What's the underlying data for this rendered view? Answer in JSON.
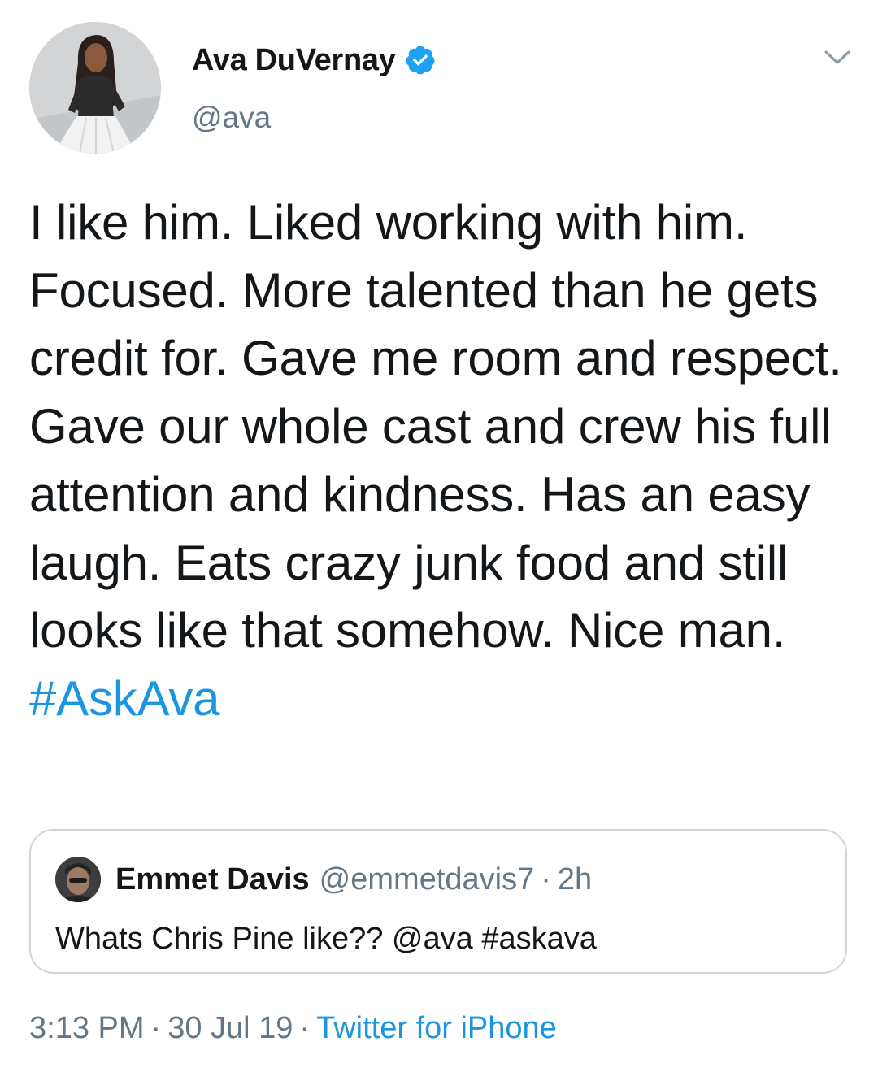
{
  "author": {
    "display_name": "Ava DuVernay",
    "handle": "@ava",
    "avatar_icon": "profile-photo",
    "verified_icon": "verified-badge-icon",
    "verified_color": "#1da1f2"
  },
  "menu": {
    "caret_icon": "chevron-down-icon"
  },
  "tweet": {
    "text": "I like him. Liked working with him. Focused. More talented than he gets credit for. Gave me room and respect. Gave our whole cast and crew his full attention and kindness. Has an easy laugh. Eats crazy junk food and still looks like that somehow. Nice man.",
    "hashtag": "#AskAva"
  },
  "quoted_tweet": {
    "display_name": "Emmet Davis",
    "handle": "@emmetdavis7",
    "separator": "·",
    "time_ago": "2h",
    "text": "Whats Chris Pine like?? @ava #askava"
  },
  "meta": {
    "time": "3:13 PM",
    "separator": "·",
    "date": "30 Jul 19",
    "source": "Twitter for iPhone"
  },
  "colors": {
    "text": "#14171a",
    "secondary": "#657786",
    "link": "#1b95e0",
    "border": "#ccd6dd"
  }
}
